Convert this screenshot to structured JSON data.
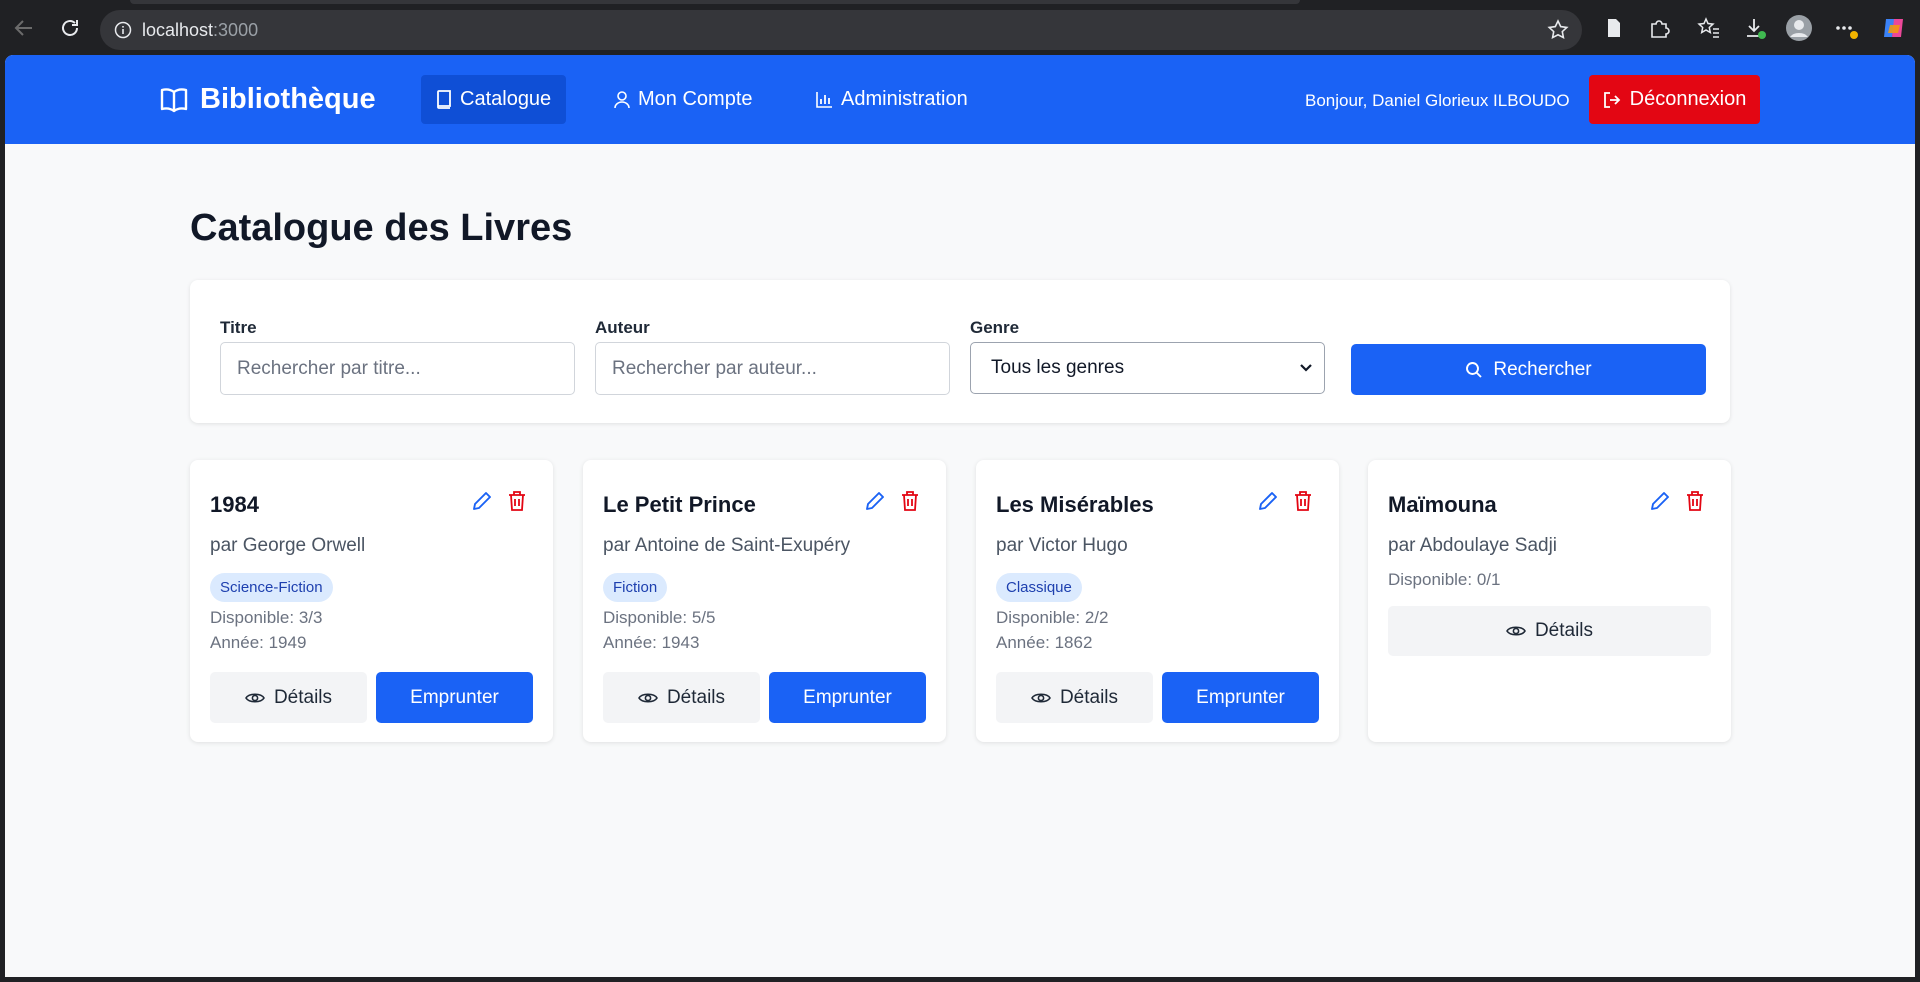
{
  "browser": {
    "url_host": "localhost",
    "url_port": ":3000"
  },
  "navbar": {
    "brand": "Bibliothèque",
    "items": [
      {
        "label": "Catalogue"
      },
      {
        "label": "Mon Compte"
      },
      {
        "label": "Administration"
      }
    ],
    "greeting": "Bonjour, Daniel Glorieux ILBOUDO",
    "logout_label": "Déconnexion"
  },
  "page": {
    "title": "Catalogue des Livres"
  },
  "filters": {
    "title_label": "Titre",
    "title_placeholder": "Rechercher par titre...",
    "author_label": "Auteur",
    "author_placeholder": "Rechercher par auteur...",
    "genre_label": "Genre",
    "genre_selected": "Tous les genres",
    "search_label": "Rechercher"
  },
  "books": [
    {
      "title": "1984",
      "author": "par George Orwell",
      "genre": "Science-Fiction",
      "available": "Disponible: 3/3",
      "year": "Année: 1949",
      "details_label": "Détails",
      "borrow_label": "Emprunter"
    },
    {
      "title": "Le Petit Prince",
      "author": "par Antoine de Saint-Exupéry",
      "genre": "Fiction",
      "available": "Disponible: 5/5",
      "year": "Année: 1943",
      "details_label": "Détails",
      "borrow_label": "Emprunter"
    },
    {
      "title": "Les Misérables",
      "author": "par Victor Hugo",
      "genre": "Classique",
      "available": "Disponible: 2/2",
      "year": "Année: 1862",
      "details_label": "Détails",
      "borrow_label": "Emprunter"
    },
    {
      "title": "Maïmouna",
      "author": "par Abdoulaye Sadji",
      "available": "Disponible: 0/1",
      "details_label": "Détails"
    }
  ],
  "colors": {
    "primary": "#1a62f5",
    "danger": "#e30613",
    "badge_bg": "#dbeafe",
    "badge_text": "#1e40af"
  }
}
